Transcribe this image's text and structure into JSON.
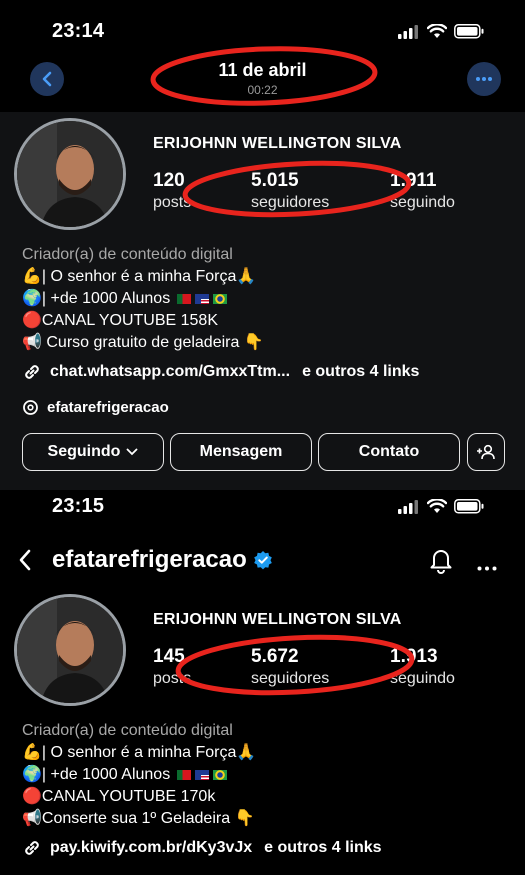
{
  "top": {
    "status_time": "23:14",
    "nav_title": "11 de abril",
    "nav_subtitle": "00:22",
    "profile": {
      "name": "ERIJOHNN WELLINGTON SILVA",
      "posts_count": "120",
      "posts_label": "posts",
      "followers_count": "5.015",
      "followers_label": "seguidores",
      "following_count": "1.911",
      "following_label": "seguindo",
      "category": "Criador(a) de conteúdo digital",
      "bio_lines": [
        "💪| O senhor é a minha Força🙏",
        "🌍| +de 1000 Alunos",
        "🔴CANAL YOUTUBE 158K",
        "📢 Curso gratuito de geladeira 👇"
      ],
      "link_text": "chat.whatsapp.com/GmxxTtm...",
      "link_more": "e outros 4 links",
      "threads_handle": "efatarefrigeracao"
    },
    "buttons": {
      "following": "Seguindo",
      "message": "Mensagem",
      "contact": "Contato"
    }
  },
  "bottom": {
    "status_time": "23:15",
    "username": "efatarefrigeracao",
    "profile": {
      "name": "ERIJOHNN WELLINGTON SILVA",
      "posts_count": "145",
      "posts_label": "posts",
      "followers_count": "5.672",
      "followers_label": "seguidores",
      "following_count": "1.913",
      "following_label": "seguindo",
      "category": "Criador(a) de conteúdo digital",
      "bio_lines": [
        "💪| O senhor é a minha Força🙏",
        "🌍| +de 1000 Alunos",
        "🔴CANAL YOUTUBE 170k",
        "📢Conserte sua 1º Geladeira 👇"
      ],
      "link_text": "pay.kiwify.com.br/dKy3vJx",
      "link_more": "e outros 4 links"
    }
  },
  "colors": {
    "annotation_red": "#e8241d",
    "verified_blue": "#1d9bf0",
    "nav_button_bg": "#20365c"
  },
  "icons": [
    "back-icon",
    "more-icon",
    "signal-icon",
    "wifi-icon",
    "battery-icon",
    "link-icon",
    "threads-icon",
    "chevron-down-icon",
    "add-person-icon",
    "verified-icon",
    "bell-icon"
  ]
}
